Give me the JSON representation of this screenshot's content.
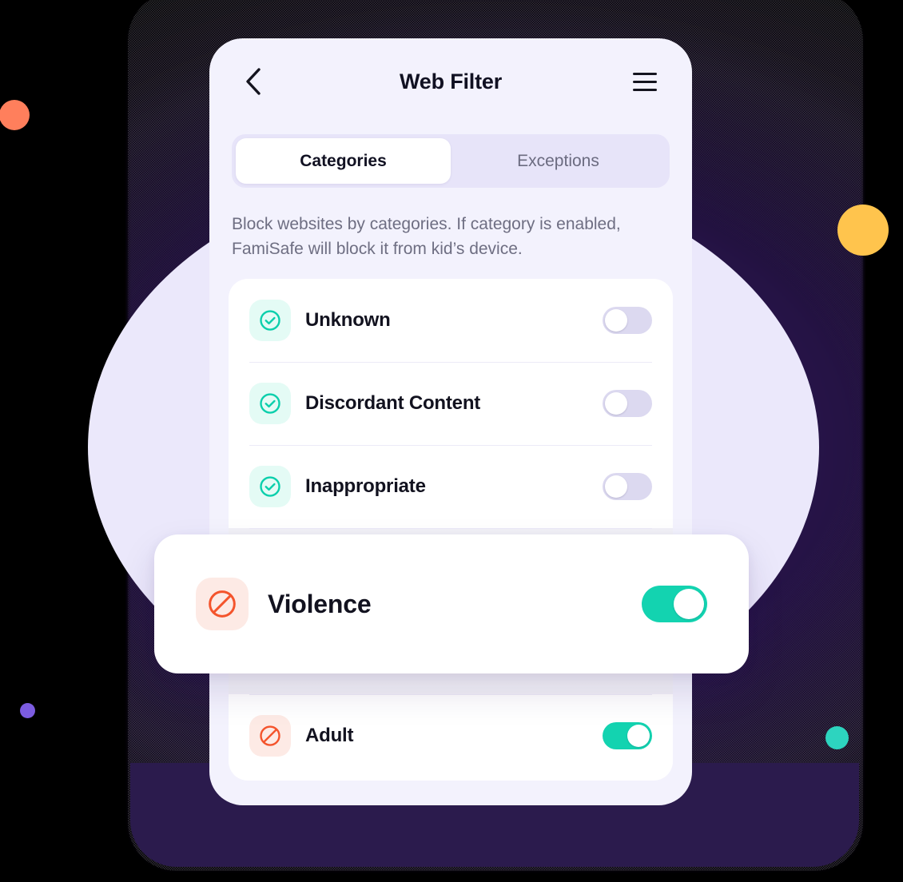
{
  "app": {
    "header": {
      "title": "Web Filter",
      "back_icon": "chevron-left-icon",
      "menu_icon": "hamburger-menu-icon"
    },
    "tabs": [
      {
        "label": "Categories",
        "active": true
      },
      {
        "label": "Exceptions",
        "active": false
      }
    ],
    "description": "Block websites by categories. If category is enabled, FamiSafe will block it from kid’s device.",
    "categories": [
      {
        "label": "Unknown",
        "icon": "check-circle-icon",
        "icon_style": "check",
        "enabled": false
      },
      {
        "label": "Discordant Content",
        "icon": "check-circle-icon",
        "icon_style": "check",
        "enabled": false
      },
      {
        "label": "Inappropriate",
        "icon": "check-circle-icon",
        "icon_style": "check",
        "enabled": false
      },
      {
        "label": "Adult",
        "icon": "block-circle-icon",
        "icon_style": "block",
        "enabled": true
      }
    ],
    "highlight_card": {
      "label": "Violence",
      "icon": "block-circle-icon",
      "enabled": true
    }
  },
  "decoration": {
    "dots": [
      {
        "name": "orange-dot",
        "color": "#ff7f5c"
      },
      {
        "name": "yellow-dot",
        "color": "#ffc44d"
      },
      {
        "name": "purple-dot",
        "color": "#7c5ce0"
      },
      {
        "name": "teal-dot",
        "color": "#2dd4bf"
      }
    ],
    "halo_color": "#ebe8fb",
    "backdrop_color": "#2b1b4d"
  },
  "colors": {
    "accent_teal": "#13d3b0",
    "accent_red": "#f4542c",
    "toggle_off": "#dcd9f0",
    "phone_bg": "#f3f2fd",
    "card_bg": "#ffffff"
  }
}
